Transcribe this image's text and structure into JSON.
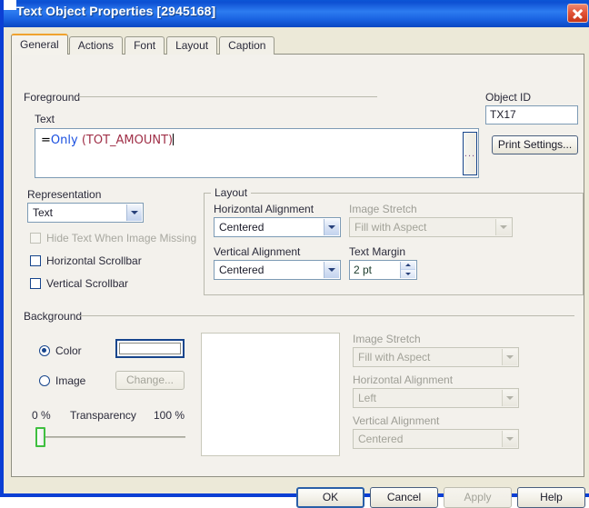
{
  "window": {
    "title": "Text Object Properties [2945168]",
    "close_label": "Close"
  },
  "tabs": [
    {
      "label": "General",
      "active": true
    },
    {
      "label": "Actions",
      "active": false
    },
    {
      "label": "Font",
      "active": false
    },
    {
      "label": "Layout",
      "active": false
    },
    {
      "label": "Caption",
      "active": false
    }
  ],
  "foreground": {
    "section_label": "Foreground",
    "text_label": "Text",
    "text_value": {
      "equals": "=",
      "function": "Only",
      "argument": " (TOT_AMOUNT)"
    },
    "ellipsis_label": "...",
    "representation_label": "Representation",
    "representation_value": "Text",
    "hide_text_label": "Hide Text When Image Missing",
    "horizontal_scrollbar_label": "Horizontal Scrollbar",
    "vertical_scrollbar_label": "Vertical Scrollbar"
  },
  "object": {
    "id_label": "Object ID",
    "id_value": "TX17",
    "print_settings_label": "Print Settings..."
  },
  "layout_group": {
    "group_label": "Layout",
    "horizontal_alignment_label": "Horizontal Alignment",
    "horizontal_alignment_value": "Centered",
    "vertical_alignment_label": "Vertical Alignment",
    "vertical_alignment_value": "Centered",
    "image_stretch_label": "Image Stretch",
    "image_stretch_value": "Fill with Aspect",
    "text_margin_label": "Text Margin",
    "text_margin_value": "2 pt"
  },
  "background": {
    "section_label": "Background",
    "color_label": "Color",
    "color_value": "#ffffff",
    "image_label": "Image",
    "change_label": "Change...",
    "transparency_label": "Transparency",
    "transparency_min": "0 %",
    "transparency_max": "100 %",
    "transparency_value": 0,
    "image_stretch_label": "Image Stretch",
    "image_stretch_value": "Fill with Aspect",
    "horizontal_alignment_label": "Horizontal Alignment",
    "horizontal_alignment_value": "Left",
    "vertical_alignment_label": "Vertical Alignment",
    "vertical_alignment_value": "Centered"
  },
  "footer": {
    "ok_label": "OK",
    "cancel_label": "Cancel",
    "apply_label": "Apply",
    "help_label": "Help"
  }
}
